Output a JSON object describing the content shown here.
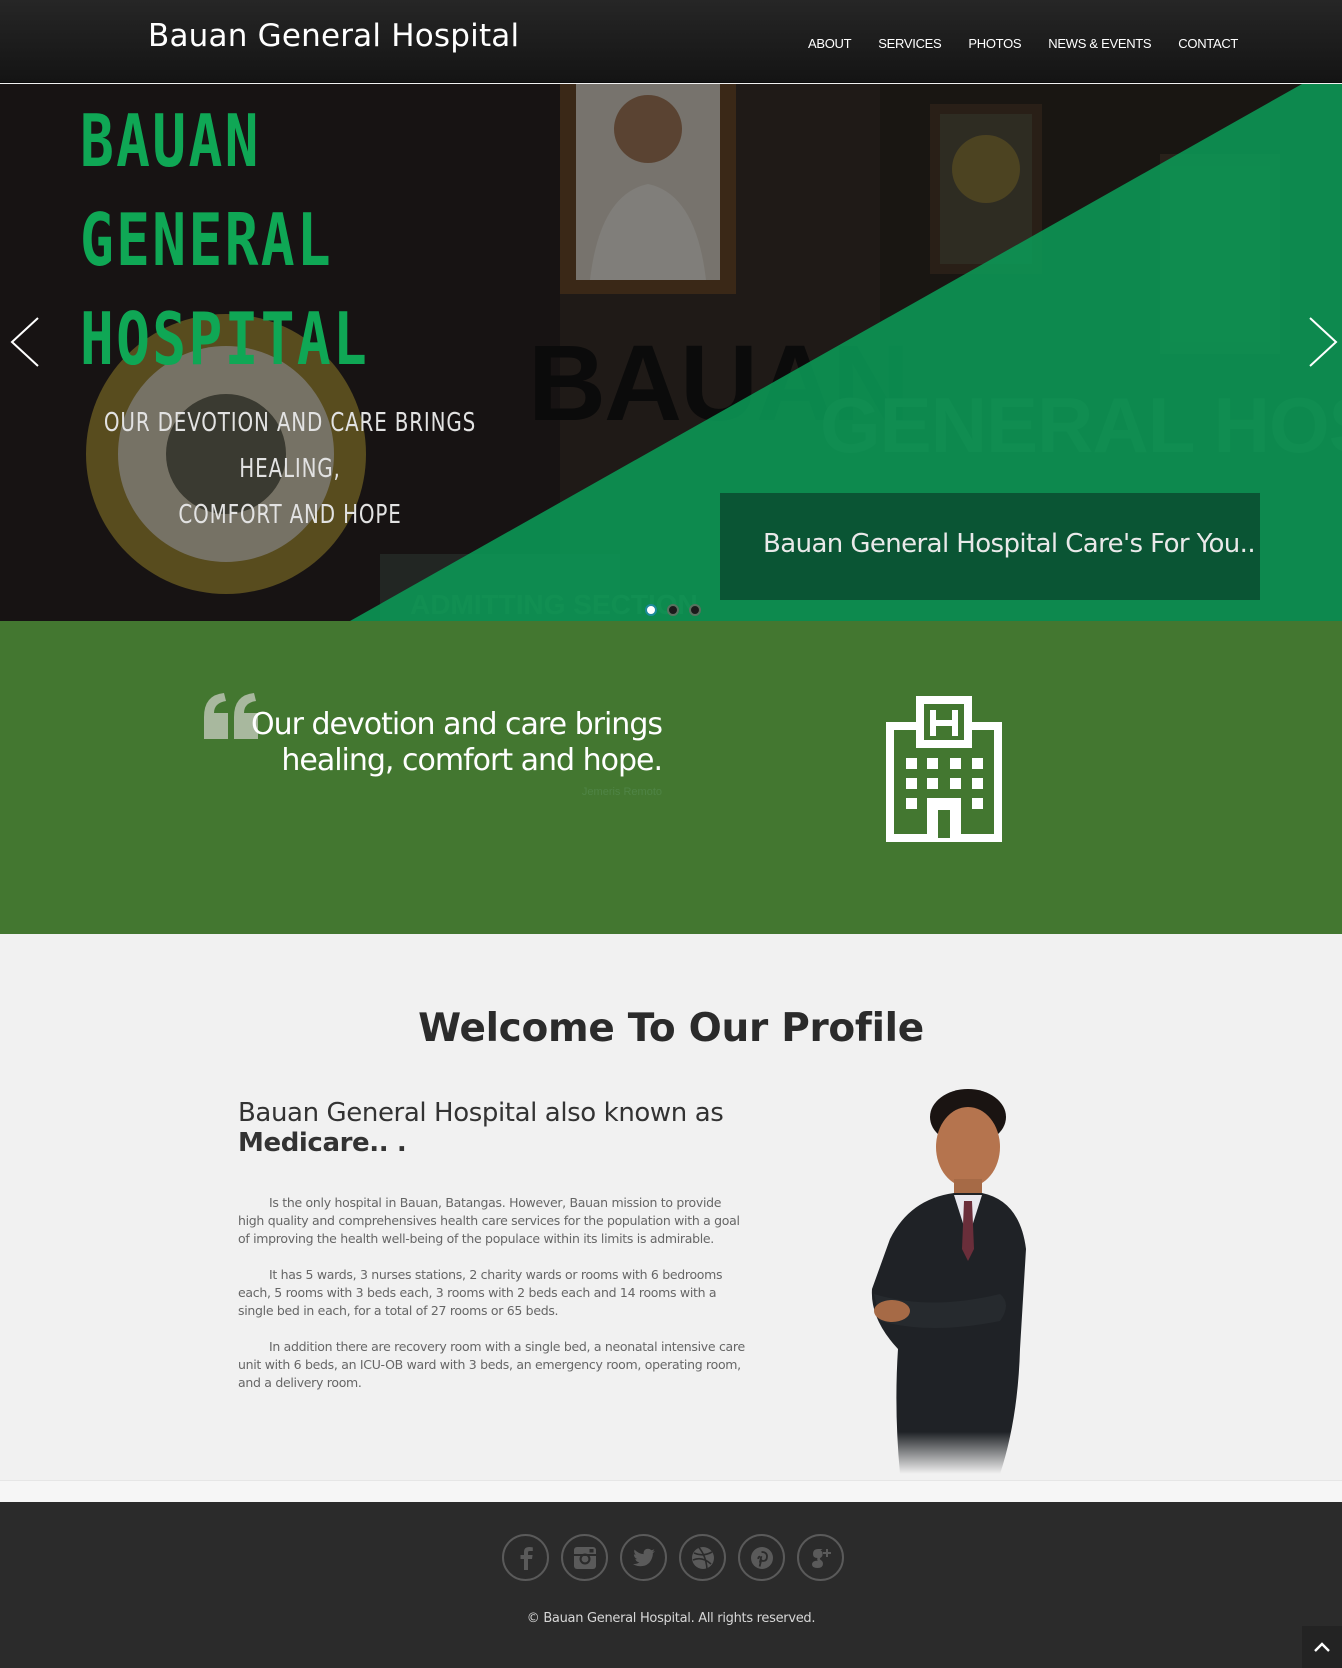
{
  "header": {
    "brand": "Bauan General Hospital",
    "nav": [
      "ABOUT",
      "SERVICES",
      "PHOTOS",
      "NEWS & EVENTS",
      "CONTACT"
    ]
  },
  "hero": {
    "title_lines": [
      "BAUAN",
      "GENERAL",
      "HOSPITAL"
    ],
    "tagline_lines": [
      "OUR DEVOTION AND CARE BRINGS HEALING,",
      "COMFORT AND HOPE"
    ],
    "background_sign": "BAUAN GENERAL HOSPITAL",
    "background_label": "ADMITTING SECTION",
    "caption": "Bauan General Hospital Care's For You..",
    "slide_count": 3,
    "active_slide": 1,
    "title_color": "#0fa755",
    "overlay_color": "#0b9a56"
  },
  "quote": {
    "text_line1": "Our devotion and care brings",
    "text_line2": "healing, comfort and hope.",
    "cite": "Jemeris Remoto",
    "band_color": "#437730"
  },
  "profile": {
    "heading": "Welcome To Our Profile",
    "sub_line1": "Bauan General Hospital also known as",
    "sub_bold": "Medicare.. .",
    "paragraphs": [
      "Is the only hospital in Bauan, Batangas. However, Bauan mission to provide high quality and comprehensives health care services for the population with a goal of improving the health well-being of the populace within its limits is admirable.",
      "It has 5 wards, 3 nurses stations, 2 charity wards or rooms with 6 bedrooms each, 5 rooms with 3 beds each, 3 rooms with 2 beds each and 14 rooms with a single bed in each, for a total of 27 rooms or 65 beds.",
      "In addition there are recovery room with a single bed, a neonatal intensive care unit with 6 beds, an ICU-OB ward with 3 beds, an emergency room, operating room, and a delivery room."
    ]
  },
  "footer": {
    "social": [
      "facebook-icon",
      "instagram-icon",
      "twitter-icon",
      "dribbble-icon",
      "pinterest-icon",
      "google-plus-icon"
    ],
    "copyright": "© Bauan General Hospital. All rights reserved."
  }
}
